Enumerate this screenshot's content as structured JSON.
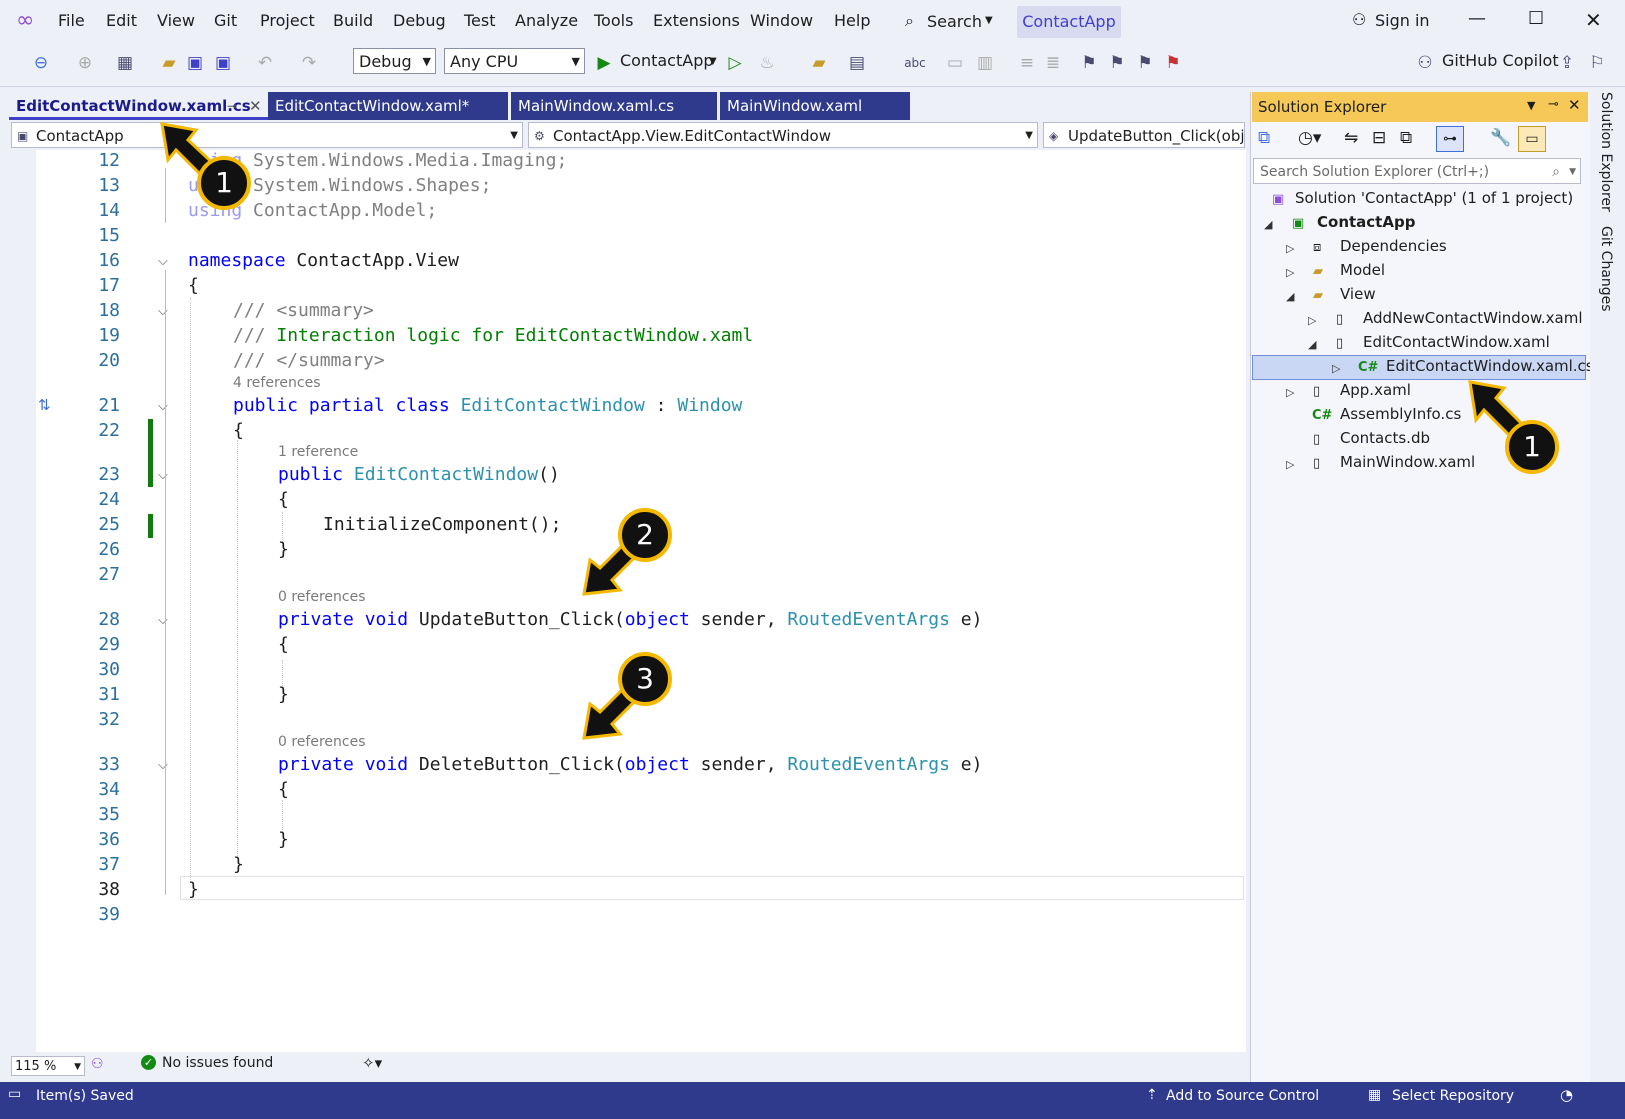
{
  "menu": {
    "items": [
      "File",
      "Edit",
      "View",
      "Git",
      "Project",
      "Build",
      "Debug",
      "Test",
      "Analyze",
      "Tools",
      "Extensions",
      "Window",
      "Help"
    ],
    "search_label": "Search",
    "app_name": "ContactApp",
    "sign_in": "Sign in"
  },
  "toolbar": {
    "config": "Debug",
    "platform": "Any CPU",
    "run_target": "ContactApp",
    "copilot": "GitHub Copilot"
  },
  "tabs": [
    {
      "label": "EditContactWindow.xaml.cs",
      "active": true
    },
    {
      "label": "EditContactWindow.xaml*",
      "active": false
    },
    {
      "label": "MainWindow.xaml.cs",
      "active": false
    },
    {
      "label": "MainWindow.xaml",
      "active": false
    }
  ],
  "navbar": {
    "project": "ContactApp",
    "type": "ContactApp.View.EditContactWindow",
    "member": "UpdateButton_Click(object sender, RoutedEventArgs e)"
  },
  "editor": {
    "lines": [
      {
        "n": "12",
        "text": "System.Windows.Media.Imaging;"
      },
      {
        "n": "13",
        "text": "System.Windows.Shapes;"
      },
      {
        "n": "14",
        "kw": "using",
        "text": "ContactApp.Model;"
      },
      {
        "n": "15"
      },
      {
        "n": "16",
        "kw": "namespace",
        "text": "ContactApp.View"
      },
      {
        "n": "17",
        "text": "{"
      },
      {
        "n": "18",
        "text": "/// <summary>"
      },
      {
        "n": "19",
        "text": "/// Interaction logic for EditContactWindow.xaml"
      },
      {
        "n": "20",
        "text": "/// </summary>"
      },
      {
        "n": "21",
        "kw": "public partial class",
        "type": "EditContactWindow",
        "sep": ":",
        "base": "Window"
      },
      {
        "n": "22",
        "text": "{"
      },
      {
        "n": "23",
        "kw": "public",
        "type": "EditContactWindow",
        "text": "()"
      },
      {
        "n": "24",
        "text": "{"
      },
      {
        "n": "25",
        "text": "InitializeComponent();"
      },
      {
        "n": "26",
        "text": "}"
      },
      {
        "n": "27"
      },
      {
        "n": "28",
        "kw": "private void",
        "name": "UpdateButton_Click(",
        "kw2": "object",
        "mid": "sender,",
        "type": "RoutedEventArgs",
        "tail": "e)"
      },
      {
        "n": "29",
        "text": "{"
      },
      {
        "n": "30"
      },
      {
        "n": "31",
        "text": "}"
      },
      {
        "n": "32"
      },
      {
        "n": "33",
        "kw": "private void",
        "name": "DeleteButton_Click(",
        "kw2": "object",
        "mid": "sender,",
        "type": "RoutedEventArgs",
        "tail": "e)"
      },
      {
        "n": "34",
        "text": "{"
      },
      {
        "n": "35"
      },
      {
        "n": "36",
        "text": "}"
      },
      {
        "n": "37",
        "text": "}"
      },
      {
        "n": "38",
        "text": "}"
      },
      {
        "n": "39"
      }
    ],
    "lens": {
      "class_refs": "4 references",
      "ctor_refs": "1 reference",
      "update_refs": "0 references",
      "delete_refs": "0 references"
    }
  },
  "editor_status": {
    "zoom": "115 %",
    "issues": "No issues found"
  },
  "status_bar": {
    "left": "Item(s) Saved",
    "source_control": "Add to Source Control",
    "repo": "Select Repository"
  },
  "solution_explorer": {
    "title": "Solution Explorer",
    "search_placeholder": "Search Solution Explorer (Ctrl+;)",
    "solution": "Solution 'ContactApp' (1 of 1 project)",
    "project": "ContactApp",
    "items": [
      "Dependencies",
      "Model",
      "View",
      "AddNewContactWindow.xaml",
      "EditContactWindow.xaml",
      "EditContactWindow.xaml.cs",
      "App.xaml",
      "AssemblyInfo.cs",
      "Contacts.db",
      "MainWindow.xaml"
    ]
  },
  "right_rail": {
    "a": "Solution Explorer",
    "b": "Git Changes"
  },
  "annotations": [
    "1",
    "1",
    "2",
    "3"
  ]
}
